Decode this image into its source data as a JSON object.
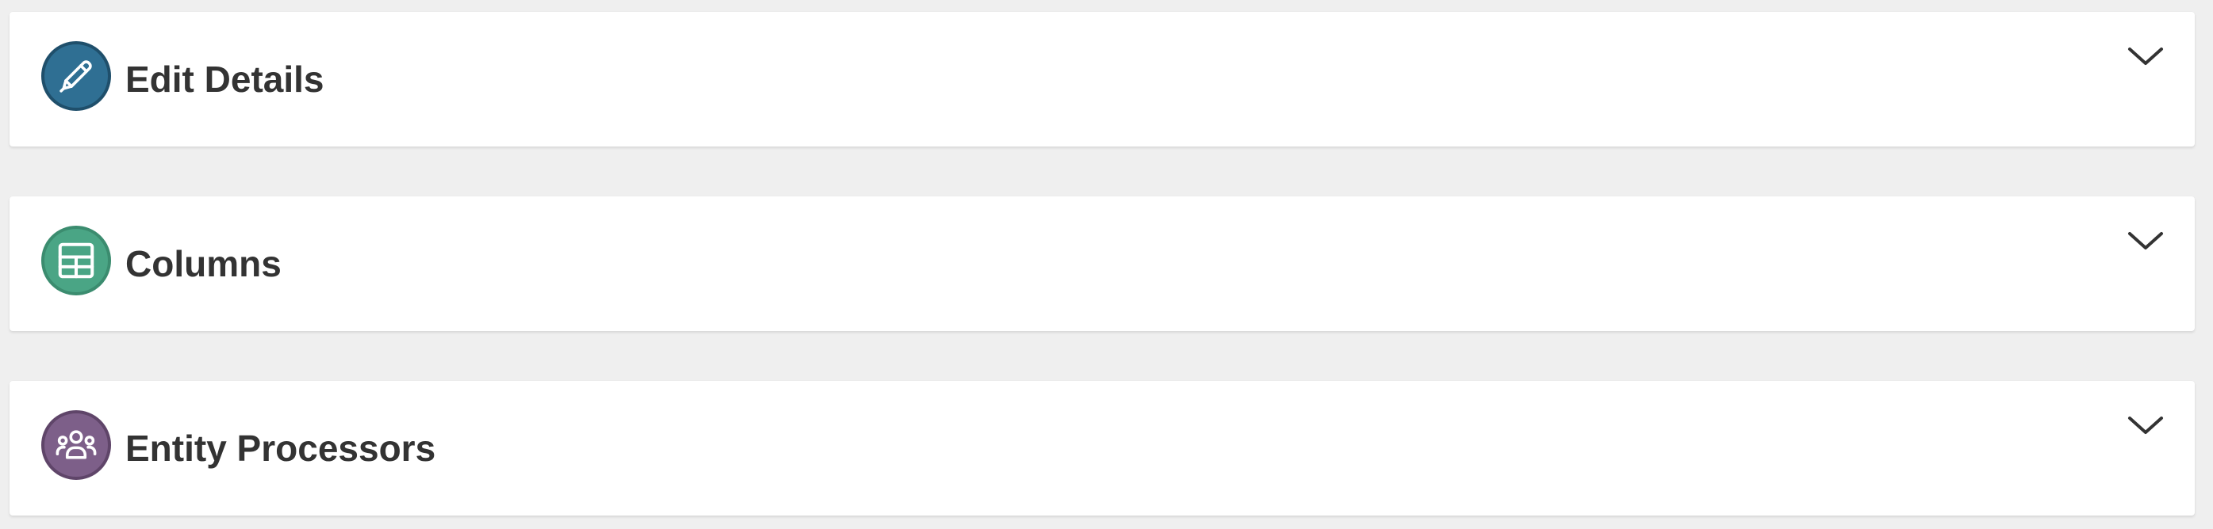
{
  "sections": [
    {
      "title": "Edit Details",
      "icon": "pencil-icon",
      "icon_bg": "#2f6f93",
      "icon_border": "#1f4f6b",
      "expanded": false
    },
    {
      "title": "Columns",
      "icon": "table-icon",
      "icon_bg": "#4aa585",
      "icon_border": "#3b8c6f",
      "expanded": false
    },
    {
      "title": "Entity Processors",
      "icon": "users-icon",
      "icon_bg": "#7d5f89",
      "icon_border": "#5f4569",
      "expanded": false
    }
  ],
  "chevron_icon": "chevron-down-icon",
  "colors": {
    "page_bg": "#efefef",
    "panel_bg": "#ffffff",
    "title_text": "#333333"
  }
}
